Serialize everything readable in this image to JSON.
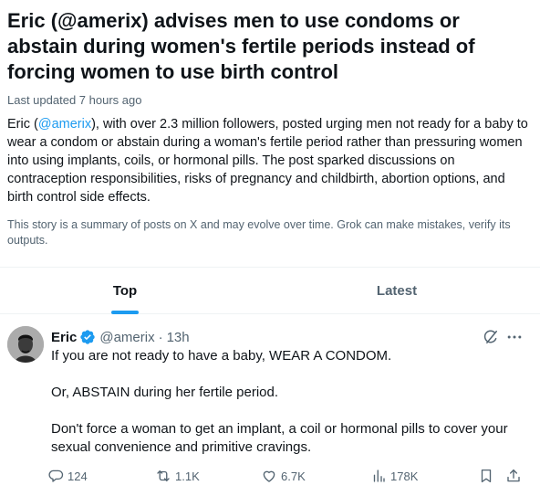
{
  "story": {
    "headline": "Eric (@amerix) advises men to use condoms or abstain during women's fertile periods instead of forcing women to use birth control",
    "updated": "Last updated 7 hours ago",
    "summary_prefix": "Eric (",
    "summary_mention": "@amerix",
    "summary_rest": "), with over 2.3 million followers, posted urging men not ready for a baby to wear a condom or abstain during a woman's fertile period rather than pressuring women into using implants, coils, or hormonal pills. The post sparked discussions on contraception responsibilities, risks of pregnancy and childbirth, abortion options, and birth control side effects.",
    "disclaimer": "This story is a summary of posts on X and may evolve over time. Grok can make mistakes, verify its outputs."
  },
  "tabs": [
    {
      "label": "Top",
      "active": true
    },
    {
      "label": "Latest",
      "active": false
    }
  ],
  "post": {
    "author": "Eric",
    "handle": "@amerix",
    "separator": "·",
    "time": "13h",
    "paragraphs": [
      "If you are not ready to have a baby, WEAR A CONDOM.",
      "Or, ABSTAIN during her fertile period.",
      "Don't force a woman to get an implant, a coil or hormonal pills to cover your sexual convenience and primitive cravings."
    ],
    "actions": {
      "replies": "124",
      "reposts": "1.1K",
      "likes": "6.7K",
      "views": "178K"
    },
    "icons": [
      "verified-badge-icon",
      "grok-icon",
      "more-icon",
      "reply-icon",
      "repost-icon",
      "like-icon",
      "views-icon",
      "bookmark-icon",
      "share-icon"
    ]
  },
  "colors": {
    "accent": "#1d9bf0",
    "text": "#0f1419",
    "secondary": "#536471"
  }
}
